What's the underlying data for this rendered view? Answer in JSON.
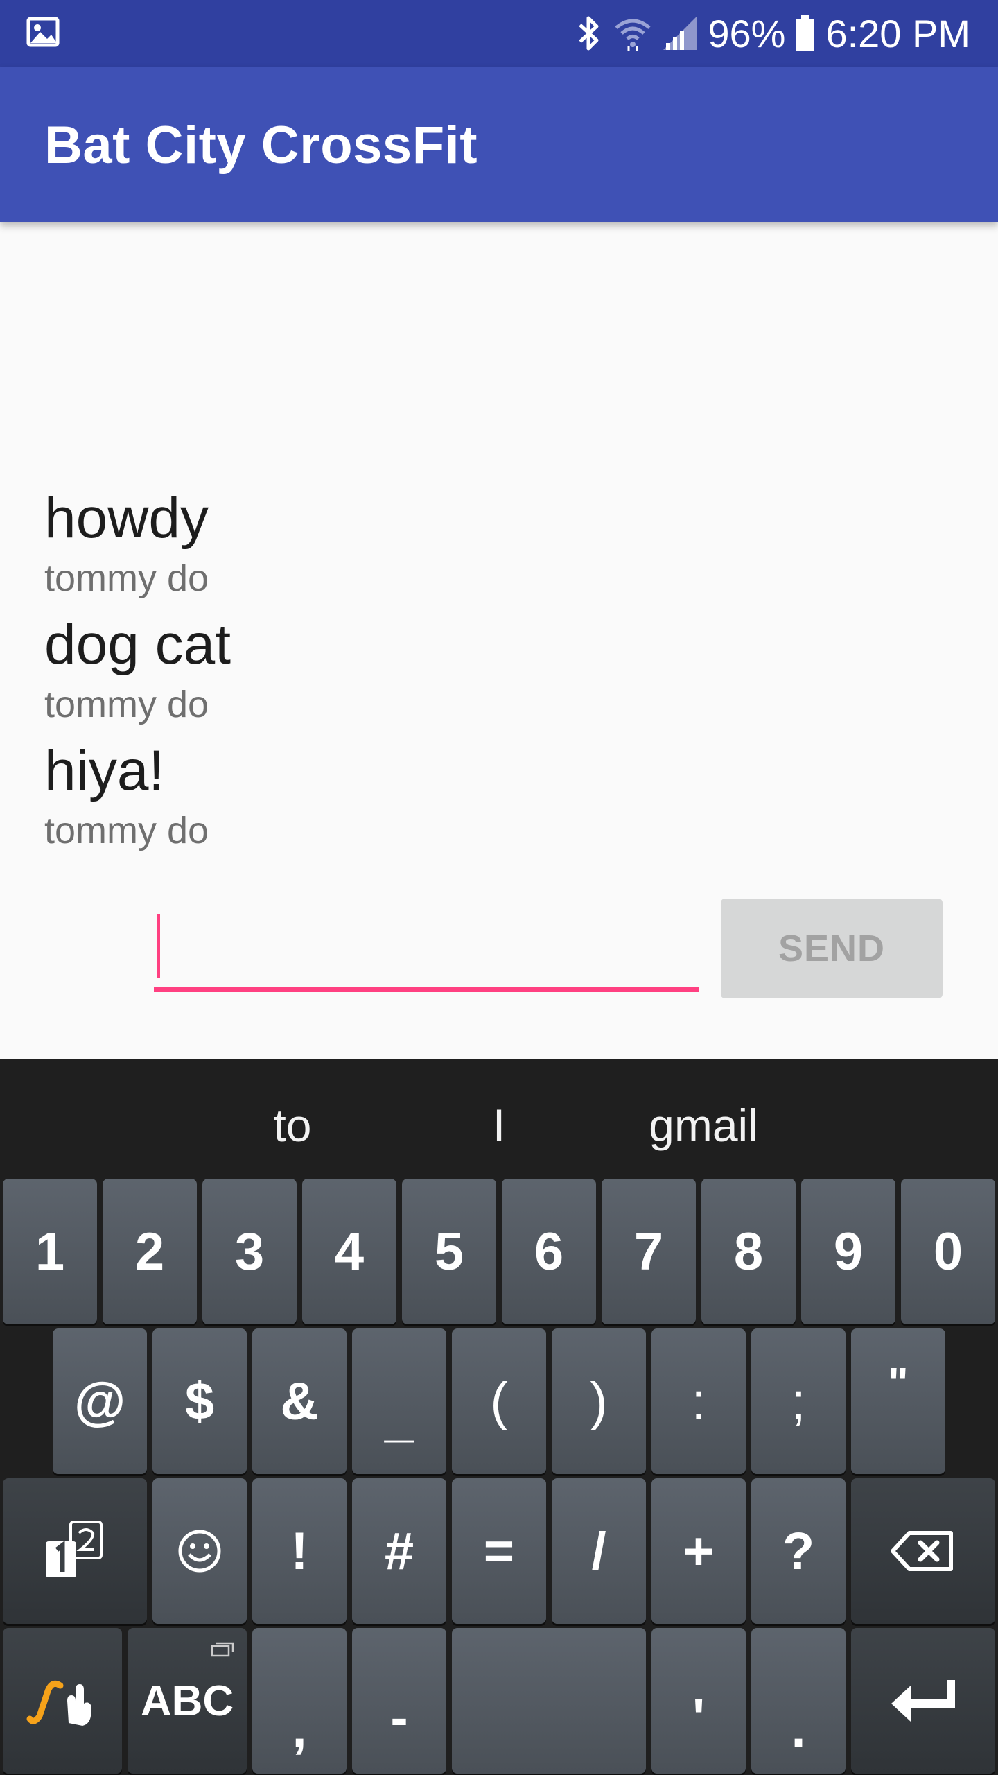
{
  "status_bar": {
    "battery_percent": "96%",
    "time": "6:20 PM",
    "icons": [
      "image-icon",
      "bluetooth-icon",
      "wifi-icon",
      "cell-signal-icon",
      "battery-icon"
    ]
  },
  "app_bar": {
    "title": "Bat City CrossFit",
    "color": "#3f51b5",
    "status_color": "#3040a0"
  },
  "messages": [
    {
      "text": "howdy",
      "author": "tommy do"
    },
    {
      "text": "dog cat",
      "author": "tommy do"
    },
    {
      "text": "hiya!",
      "author": "tommy do"
    }
  ],
  "composer": {
    "input_value": "",
    "send_label": "SEND",
    "accent": "#ff4081"
  },
  "keyboard": {
    "suggestions": [
      "to",
      "I",
      "gmail"
    ],
    "row1": [
      "1",
      "2",
      "3",
      "4",
      "5",
      "6",
      "7",
      "8",
      "9",
      "0"
    ],
    "row2": [
      "@",
      "$",
      "&",
      "_",
      "(",
      ")",
      ":",
      ";",
      "\""
    ],
    "row3": [
      "!",
      "#",
      "=",
      "/",
      "+",
      "?"
    ],
    "row4": {
      "abc_label": "ABC",
      "comma": ",",
      "dash": "-",
      "apostrophe": "'",
      "period": "."
    }
  }
}
